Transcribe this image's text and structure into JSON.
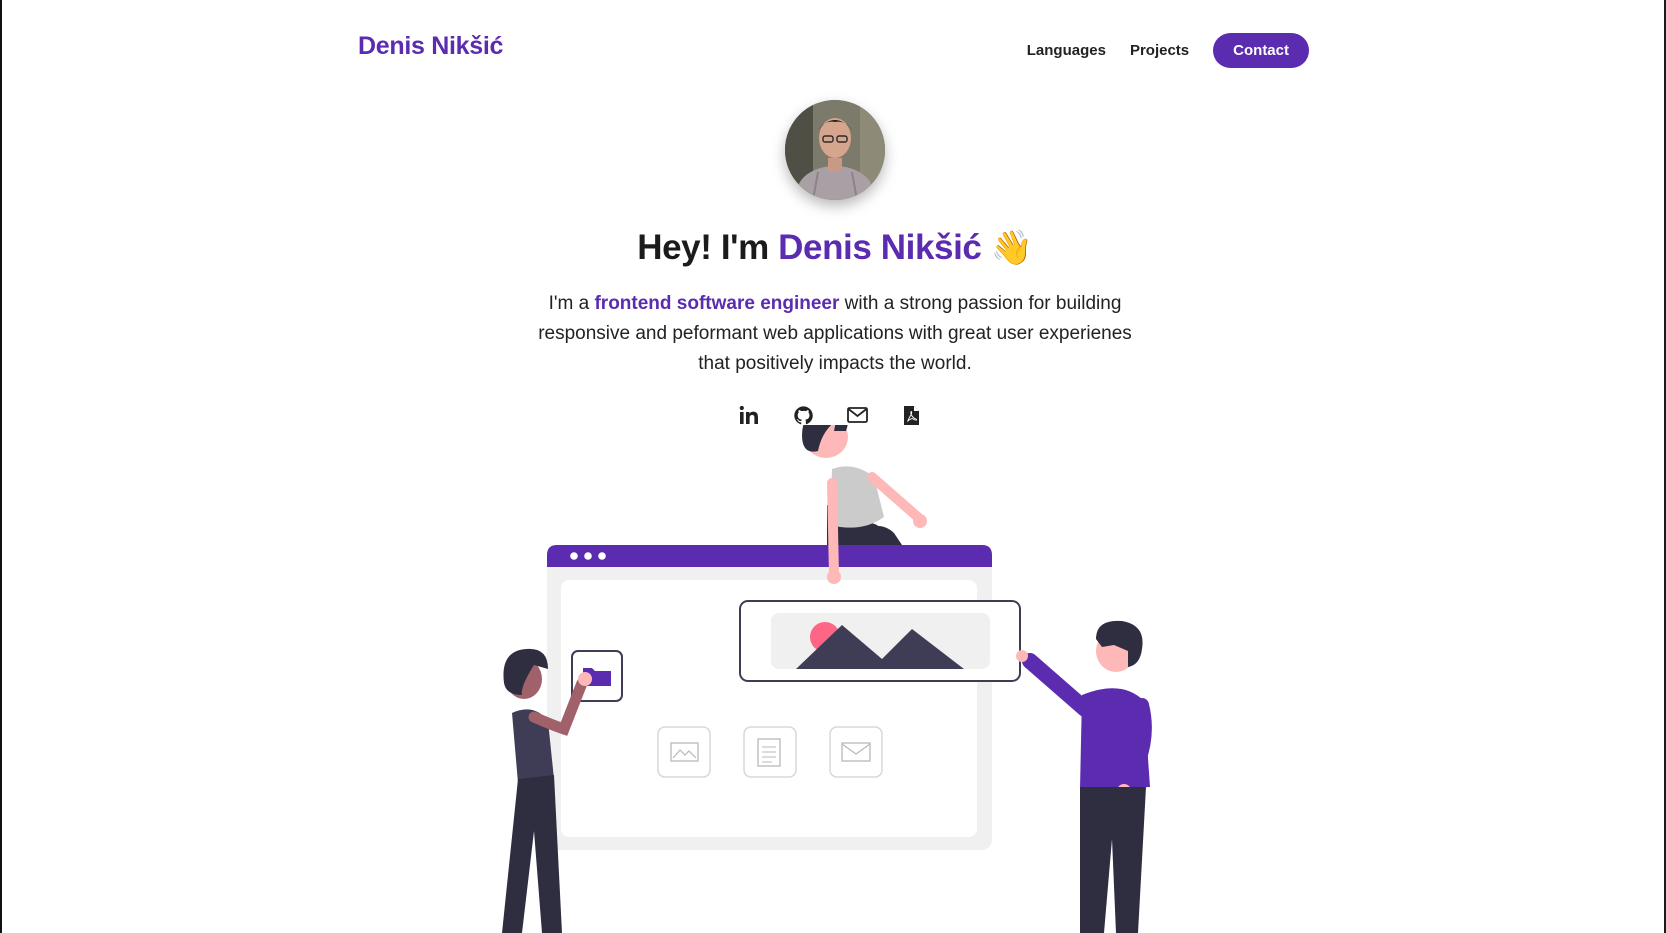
{
  "header": {
    "brand": "Denis Nikšić",
    "nav": [
      "Languages",
      "Projects"
    ],
    "contact_label": "Contact"
  },
  "hero": {
    "greeting": "Hey! I'm",
    "name": "Denis Nikšić",
    "wave_emoji": "👋",
    "bio_prefix": "I'm a",
    "bio_highlight": "frontend software engineer",
    "bio_suffix": "with a strong passion for building responsive and peformant web applications with great user experienes that positively impacts the world."
  },
  "socials": [
    {
      "icon": "linkedin-icon"
    },
    {
      "icon": "github-icon"
    },
    {
      "icon": "email-icon"
    },
    {
      "icon": "pdf-icon"
    }
  ],
  "colors": {
    "accent": "#5b2bb0",
    "dark": "#3f3d56",
    "pink": "#ff6584"
  }
}
